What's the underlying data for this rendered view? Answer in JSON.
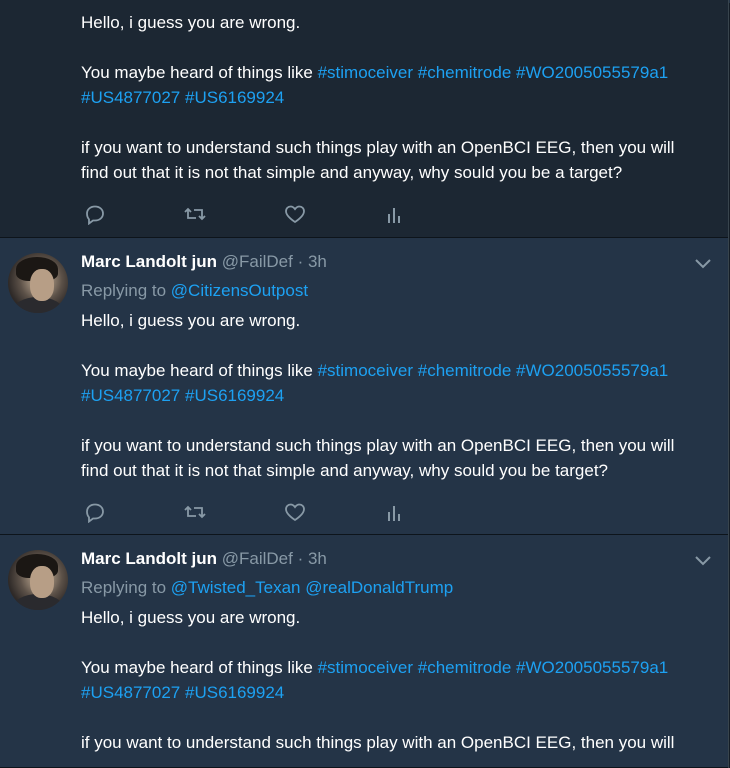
{
  "tweets": [
    {
      "body": {
        "line1": "Hello, i guess you are wrong.",
        "line2_prefix": "You maybe heard of things like",
        "tags_line2": [
          "#stimoceiver",
          "#chemitrode",
          "#WO2005055579a1"
        ],
        "tags_line3": [
          "#US4877027",
          "#US6169924"
        ],
        "line4": "if you want to understand such things play with an OpenBCI EEG, then you will",
        "line5": "find out that it is not that simple and anyway, why sould you be a target?"
      }
    },
    {
      "author": {
        "name": "Marc Landolt jun",
        "handle": "@FailDef",
        "time": "· 3h"
      },
      "replying_label": "Replying to",
      "mentions": [
        "@CitizensOutpost"
      ],
      "body": {
        "line1": "Hello, i guess you are wrong.",
        "line2_prefix": "You maybe heard of things like",
        "tags_line2": [
          "#stimoceiver",
          "#chemitrode",
          "#WO2005055579a1"
        ],
        "tags_line3": [
          "#US4877027",
          "#US6169924"
        ],
        "line4": "if you want to understand such things play with an OpenBCI EEG, then you will",
        "line5": "find out that it is not that simple and anyway, why sould you be target?"
      }
    },
    {
      "author": {
        "name": "Marc Landolt jun",
        "handle": "@FailDef",
        "time": "· 3h"
      },
      "replying_label": "Replying to",
      "mentions": [
        "@Twisted_Texan",
        "@realDonaldTrump"
      ],
      "body": {
        "line1": "Hello, i guess you are wrong.",
        "line2_prefix": "You maybe heard of things like",
        "tags_line2": [
          "#stimoceiver",
          "#chemitrode",
          "#WO2005055579a1"
        ],
        "tags_line3": [
          "#US4877027",
          "#US6169924"
        ],
        "line4": "if you want to understand such things play with an OpenBCI EEG, then you will"
      }
    }
  ],
  "icons": [
    "reply-icon",
    "retweet-icon",
    "like-icon",
    "analytics-icon",
    "chevron-down-icon"
  ],
  "colors": {
    "background": "#1c2733",
    "card": "#243447",
    "link": "#1da1f2",
    "muted": "#8899a6",
    "text": "#ffffff"
  },
  "scroll_progress_percent": 12
}
